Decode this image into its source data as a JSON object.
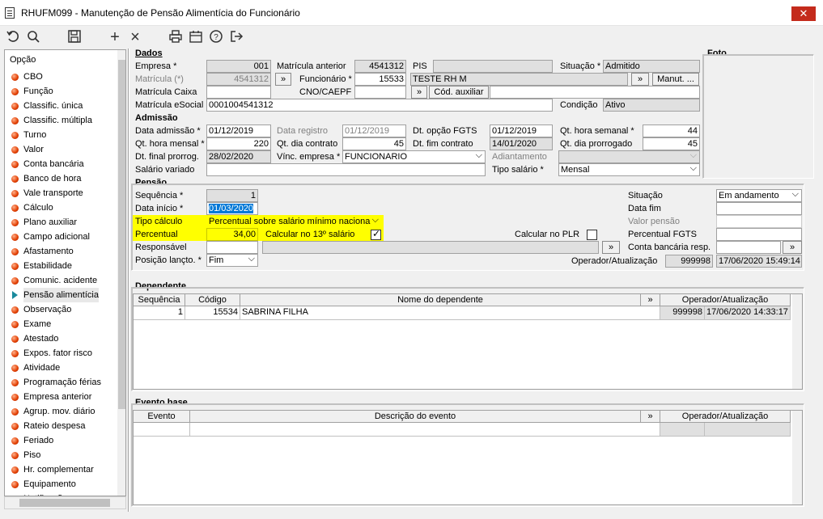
{
  "window": {
    "title": "RHUFM099 - Manutenção de Pensão Alimentícia do Funcionário",
    "close": "✕"
  },
  "toolbar": {
    "undo": "↺",
    "search": "⚲",
    "save": "💾",
    "add": "+",
    "delete": "×",
    "print": "⎙",
    "calendar": "📅",
    "help": "?",
    "exit": "⇥"
  },
  "left": {
    "header": "Opção",
    "items": [
      "CBO",
      "Função",
      "Classific. única",
      "Classific. múltipla",
      "Turno",
      "Valor",
      "Conta bancária",
      "Banco de hora",
      "Vale transporte",
      "Cálculo",
      "Plano auxiliar",
      "Campo adicional",
      "Afastamento",
      "Estabilidade",
      "Comunic. acidente",
      "Pensão alimentícia",
      "Observação",
      "Exame",
      "Atestado",
      "Expos. fator risco",
      "Atividade",
      "Programação férias",
      "Empresa anterior",
      "Agrup. mov. diário",
      "Rateio despesa",
      "Feriado",
      "Piso",
      "Hr. complementar",
      "Equipamento",
      "Notificação"
    ],
    "selected_index": 15
  },
  "dados": {
    "header": "Dados",
    "empresa_lbl": "Empresa *",
    "empresa": "001",
    "matricula_lbl": "Matrícula (*)",
    "matricula": "4541312",
    "matricula_caixa_lbl": "Matrícula Caixa",
    "matricula_caixa": "",
    "matricula_esocial_lbl": "Matrícula eSocial",
    "matricula_esocial": "0001004541312",
    "matricula_anterior_lbl": "Matrícula anterior",
    "matricula_anterior": "4541312",
    "funcionario_lbl": "Funcionário *",
    "funcionario": "15533",
    "cno_lbl": "CNO/CAEPF",
    "cno": "",
    "pis_lbl": "PIS",
    "pis": "",
    "nome": "TESTE RH M",
    "cod_auxiliar_btn": "Cód. auxiliar",
    "cod_auxiliar": "",
    "situacao_lbl": "Situação *",
    "situacao": "Admitido",
    "manut_btn": "Manut. ...",
    "condicao_lbl": "Condição",
    "condicao": "Ativo",
    "nav_btn": "»"
  },
  "foto": {
    "header": "Foto"
  },
  "admissao": {
    "header": "Admissão",
    "data_admissao_lbl": "Data admissão *",
    "data_admissao": "01/12/2019",
    "qt_hora_mensal_lbl": "Qt. hora mensal *",
    "qt_hora_mensal": "220",
    "dt_final_prorrog_lbl": "Dt. final prorrog.",
    "dt_final_prorrog": "28/02/2020",
    "salario_variado_lbl": "Salário variado",
    "salario_variado": "",
    "data_registro_lbl": "Data registro",
    "data_registro": "01/12/2019",
    "qt_dia_contrato_lbl": "Qt. dia contrato",
    "qt_dia_contrato": "45",
    "vinc_empresa_lbl": "Vínc. empresa *",
    "vinc_empresa": "FUNCIONARIO",
    "dt_opcao_fgts_lbl": "Dt. opção FGTS",
    "dt_opcao_fgts": "01/12/2019",
    "dt_fim_contrato_lbl": "Dt. fim contrato",
    "dt_fim_contrato": "14/01/2020",
    "adiantamento_lbl": "Adiantamento",
    "adiantamento": "",
    "tipo_salario_lbl": "Tipo salário *",
    "tipo_salario": "Mensal",
    "qt_hora_semanal_lbl": "Qt. hora semanal *",
    "qt_hora_semanal": "44",
    "qt_dia_prorrogado_lbl": "Qt. dia prorrogado",
    "qt_dia_prorrogado": "45"
  },
  "pensao": {
    "header": "Pensão",
    "sequencia_lbl": "Sequência *",
    "sequencia": "1",
    "data_inicio_lbl": "Data início *",
    "data_inicio": "01/03/2020",
    "tipo_calculo_lbl": "Tipo cálculo",
    "tipo_calculo": "Percentual sobre salário mínimo naciona",
    "percentual_lbl": "Percentual",
    "percentual": "34,00",
    "calc_13_lbl": "Calcular no 13º salário",
    "calc_13_checked": true,
    "calc_plr_lbl": "Calcular no PLR",
    "calc_plr_checked": false,
    "responsavel_lbl": "Responsável",
    "responsavel": "",
    "posicao_lbl": "Posição lançto. *",
    "posicao": "Fim",
    "situacao_lbl": "Situação",
    "situacao": "Em andamento",
    "data_fim_lbl": "Data fim",
    "data_fim": "",
    "valor_pensao_lbl": "Valor pensão",
    "valor_pensao": "",
    "percentual_fgts_lbl": "Percentual FGTS",
    "percentual_fgts": "",
    "conta_bancaria_lbl": "Conta bancária resp.",
    "conta_bancaria": "",
    "operador_lbl": "Operador/Atualização",
    "operador": "999998",
    "atualizacao": "17/06/2020 15:49:14"
  },
  "dependente": {
    "header": "Dependente",
    "columns": [
      "Sequência",
      "Código",
      "Nome do dependente",
      "»",
      "Operador/Atualização"
    ],
    "rows": [
      {
        "seq": "1",
        "codigo": "15534",
        "nome": "SABRINA FILHA",
        "operador": "999998",
        "atualizacao": "17/06/2020 14:33:17"
      }
    ]
  },
  "evento": {
    "header": "Evento base",
    "columns": [
      "Evento",
      "Descrição do evento",
      "»",
      "Operador/Atualização"
    ]
  },
  "colors": {
    "highlight": "#ffff00",
    "close": "#c42b1c",
    "selected_date": "#0078d7"
  }
}
